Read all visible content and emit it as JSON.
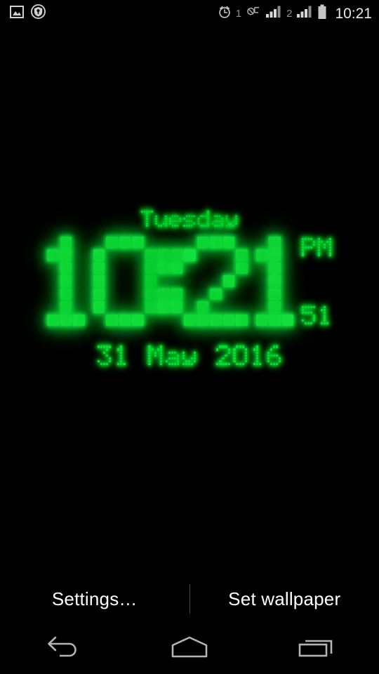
{
  "status_bar": {
    "left_icons": [
      {
        "name": "screenshot-image-icon",
        "label": "image"
      },
      {
        "name": "location-shield-icon",
        "label": "location"
      }
    ],
    "alarm_count": "1",
    "sim2_label": "2",
    "clock": "10:21",
    "right_icons": [
      {
        "name": "alarm-clock-icon",
        "label": "alarm"
      },
      {
        "name": "mute-ringer-icon",
        "label": "silent"
      },
      {
        "name": "signal-bars-sim1-icon",
        "label": "signal 1"
      },
      {
        "name": "signal-bars-sim2-icon",
        "label": "signal 2"
      },
      {
        "name": "battery-icon",
        "label": "battery"
      }
    ]
  },
  "clock": {
    "weekday": "Tuesday",
    "hours": "10",
    "minutes": "21",
    "separator": ":",
    "meridiem": "PM",
    "seconds": "51",
    "date": "31 May 2016",
    "led_color": "#12e03a",
    "glow_color": "#0bdc33",
    "background": "#000000"
  },
  "actions": {
    "settings_label": "Settings…",
    "set_wallpaper_label": "Set wallpaper"
  },
  "nav_bar": {
    "back_label": "Back",
    "home_label": "Home",
    "recents_label": "Recent apps"
  }
}
